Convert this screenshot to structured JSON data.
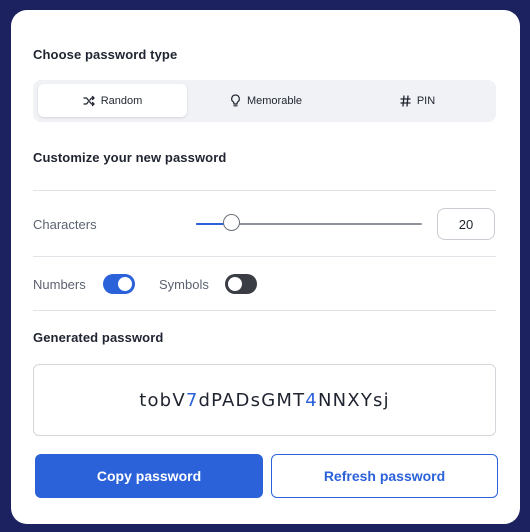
{
  "password_type": {
    "heading": "Choose password type",
    "tabs": [
      {
        "label": "Random",
        "icon": "shuffle-icon",
        "active": true
      },
      {
        "label": "Memorable",
        "icon": "lightbulb-icon",
        "active": false
      },
      {
        "label": "PIN",
        "icon": "hash-icon",
        "active": false
      }
    ]
  },
  "customize": {
    "heading": "Customize your new password",
    "characters_label": "Characters",
    "characters_value": "20",
    "slider_level": 0.16,
    "numbers_label": "Numbers",
    "numbers_on": true,
    "symbols_label": "Symbols",
    "symbols_on": false
  },
  "generated": {
    "heading": "Generated password",
    "password": "tobV7dPADsGMT4NNXYsj"
  },
  "actions": {
    "copy_label": "Copy password",
    "refresh_label": "Refresh password"
  },
  "colors": {
    "background": "#1c2160",
    "accent": "#2b62d9"
  }
}
